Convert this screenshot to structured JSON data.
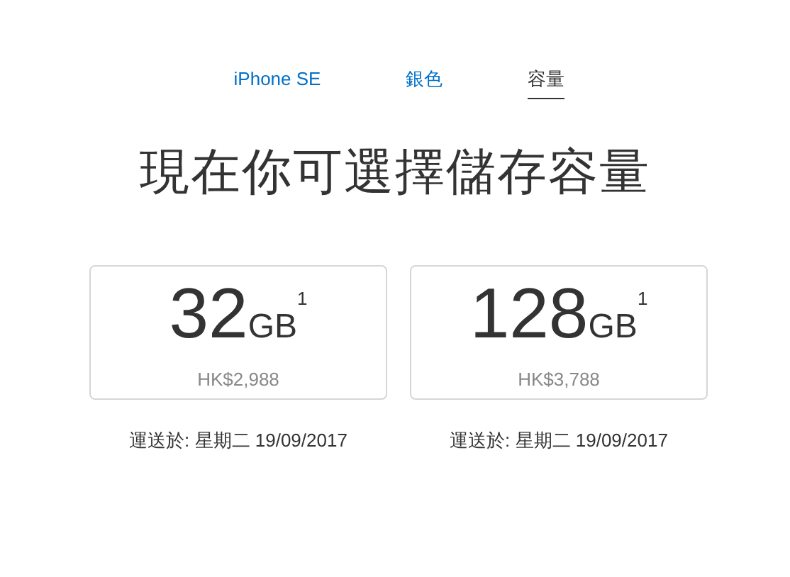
{
  "tabs": [
    {
      "label": "iPhone SE",
      "selected": false
    },
    {
      "label": "銀色",
      "selected": false
    },
    {
      "label": "容量",
      "selected": true
    }
  ],
  "heading": "現在你可選擇儲存容量",
  "options": [
    {
      "capacity": "32",
      "unit": "GB",
      "note": "1",
      "price": "HK$2,988",
      "delivery": "運送於: 星期二 19/09/2017"
    },
    {
      "capacity": "128",
      "unit": "GB",
      "note": "1",
      "price": "HK$3,788",
      "delivery": "運送於: 星期二 19/09/2017"
    }
  ]
}
